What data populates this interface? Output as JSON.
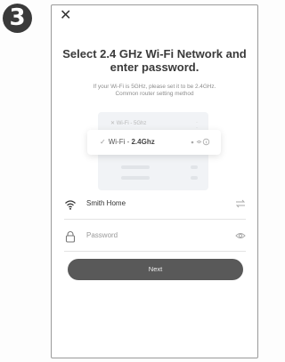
{
  "step_number": "3",
  "title_line1": "Select 2.4 GHz Wi-Fi Network and",
  "title_line2": "enter password.",
  "subtitle_line1": "If your Wi-Fi is 5GHz, please set it to be 2.4GHz.",
  "subtitle_line2": "Common router setting method",
  "illustration": {
    "network_5g": "Wi-Fi - 5Ghz",
    "network_24_prefix": "Wi-Fi - ",
    "network_24_band": "2.4Ghz"
  },
  "wifi_field": {
    "value": "Smith Home",
    "icon": "wifi-icon",
    "right_icon": "switch-network-icon"
  },
  "password_field": {
    "placeholder": "Password",
    "icon": "lock-icon",
    "right_icon": "eye-icon"
  },
  "next_label": "Next",
  "colors": {
    "button": "#595959",
    "badge": "#3a3a3a",
    "title": "#3a3a3a"
  }
}
